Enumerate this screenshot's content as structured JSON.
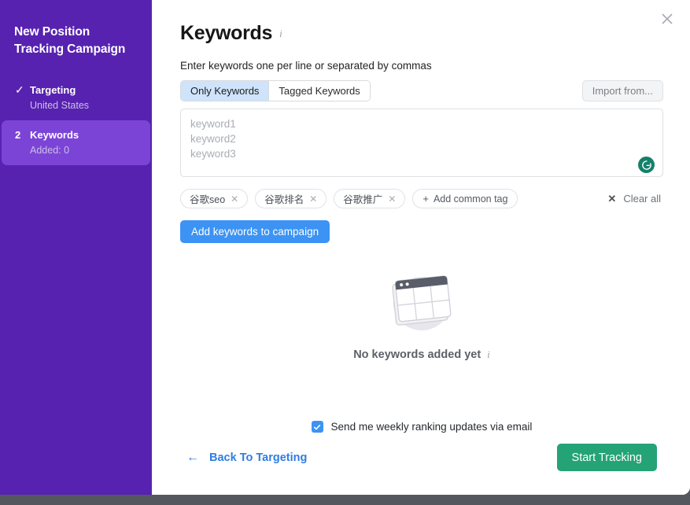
{
  "sidebar": {
    "title": "New Position Tracking Campaign",
    "steps": [
      {
        "marker": "✓",
        "label": "Targeting",
        "sub": "United States",
        "active": false
      },
      {
        "marker": "2",
        "label": "Keywords",
        "sub": "Added: 0",
        "active": true
      }
    ]
  },
  "main": {
    "close_icon": "close-icon",
    "title": "Keywords",
    "title_info_icon": "info-icon",
    "subtitle": "Enter keywords one per line or separated by commas",
    "segmented": {
      "options": [
        {
          "label": "Only Keywords",
          "selected": true
        },
        {
          "label": "Tagged Keywords",
          "selected": false
        }
      ]
    },
    "import_button": "Import from...",
    "textarea": {
      "value": "",
      "placeholder": "keyword1\nkeyword2\nkeyword3",
      "assistant_icon": "grammarly-icon",
      "assistant_glyph": "G"
    },
    "tags": [
      {
        "label": "谷歌seo",
        "remove_icon": "close-icon"
      },
      {
        "label": "谷歌排名",
        "remove_icon": "close-icon"
      },
      {
        "label": "谷歌推广",
        "remove_icon": "close-icon"
      }
    ],
    "add_common_tag": {
      "plus": "+",
      "label": "Add common tag"
    },
    "clear_all": {
      "icon": "close-icon",
      "label": "Clear all"
    },
    "add_keywords_button": "Add keywords to campaign",
    "empty_state": {
      "illustration_icon": "empty-table-illustration",
      "text": "No keywords added yet",
      "info_icon": "info-icon"
    },
    "footer": {
      "checkbox": {
        "checked": true,
        "label": "Send me weekly ranking updates via email",
        "check_glyph": "✓"
      },
      "back_link": {
        "arrow": "←",
        "label": "Back To Targeting"
      },
      "start_button": "Start Tracking"
    }
  },
  "colors": {
    "sidebar_bg": "#5722b0",
    "sidebar_active": "#7c44d6",
    "primary_blue": "#3c93f4",
    "link_blue": "#2f7de1",
    "success_green": "#24a376",
    "grammarly_green": "#15806b",
    "segment_selected": "#cfe4fb",
    "page_bg": "#54575e"
  }
}
